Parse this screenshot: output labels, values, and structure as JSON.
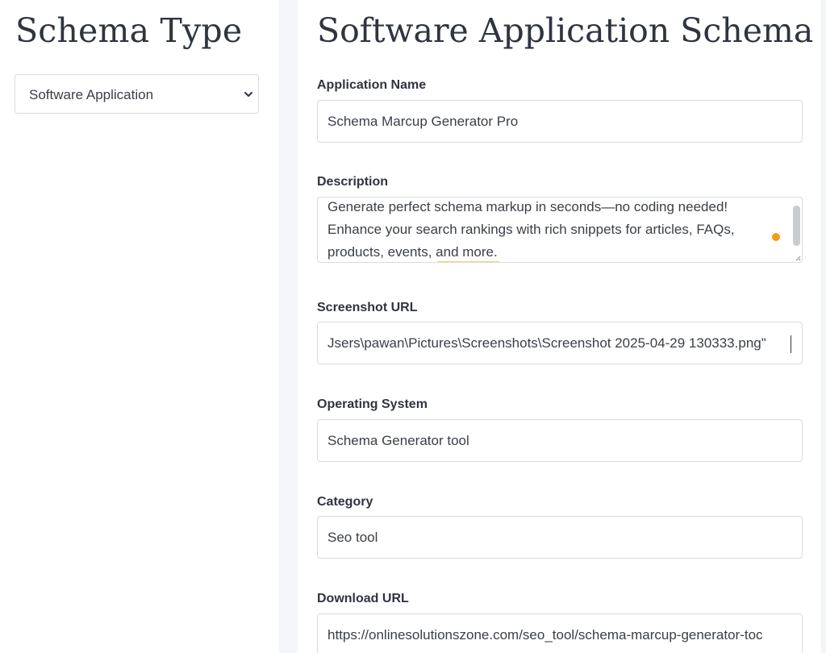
{
  "sidebar": {
    "title": "Schema Type",
    "schema_select": {
      "selected": "Software Application"
    }
  },
  "main": {
    "title": "Software Application Schema",
    "fields": {
      "application_name": {
        "label": "Application Name",
        "value": "Schema Marcup Generator Pro"
      },
      "description": {
        "label": "Description",
        "lines": [
          "Generate perfect schema markup in seconds—no coding needed!",
          "Enhance your search rankings with rich snippets for articles, FAQs,",
          "products, events, and more."
        ]
      },
      "screenshot_url": {
        "label": "Screenshot URL",
        "value": "Jsers\\pawan\\Pictures\\Screenshots\\Screenshot 2025-04-29 130333.png\""
      },
      "operating_system": {
        "label": "Operating System",
        "value": "Schema Generator tool"
      },
      "category": {
        "label": "Category",
        "value": "Seo tool"
      },
      "download_url": {
        "label": "Download URL",
        "value": "https://onlinesolutionszone.com/seo_tool/schema-marcup-generator-toc"
      }
    }
  },
  "colors": {
    "page_background": "#f4f5f8",
    "panel_background": "#ffffff",
    "text_dark": "#2f3440",
    "border": "#d9dce1",
    "notification_dot": "#f59a15",
    "spellcheck_underline": "#f1d66a"
  }
}
